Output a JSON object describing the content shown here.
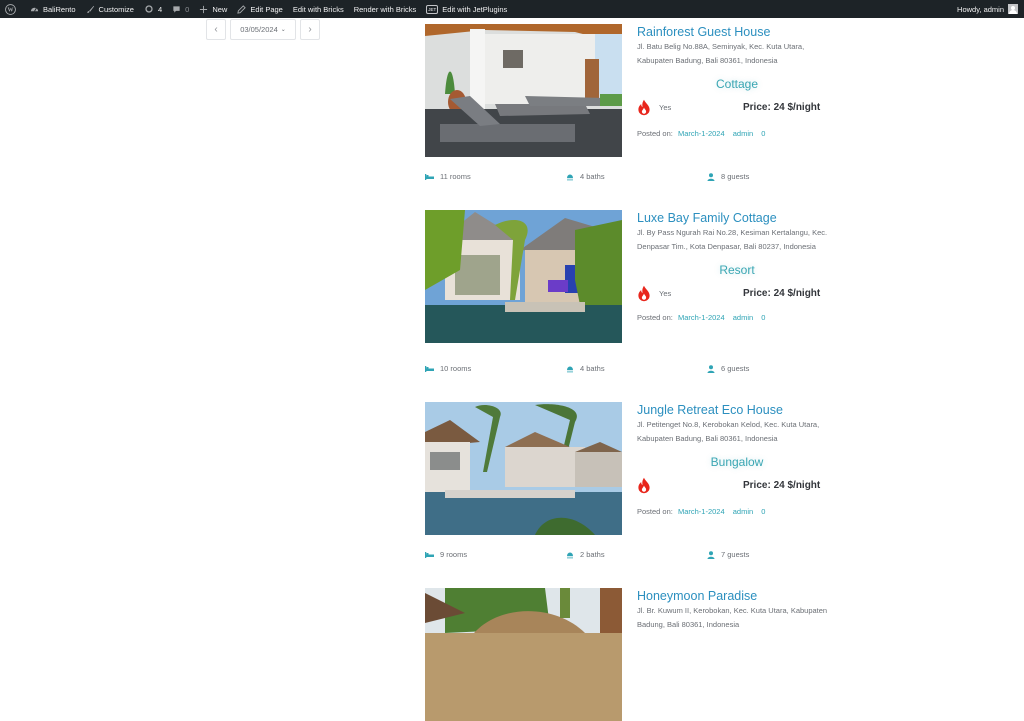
{
  "adminbar": {
    "site_name": "BaliRento",
    "customize": "Customize",
    "updates_count": "4",
    "comments_count": "0",
    "new": "New",
    "edit_page": "Edit Page",
    "edit_bricks": "Edit with Bricks",
    "render_bricks": "Render with Bricks",
    "jet_badge": "JET",
    "edit_jetplugins": "Edit with JetPlugins",
    "howdy": "Howdy, admin"
  },
  "datenav": {
    "prev": "‹",
    "date": "03/05/2024",
    "caret": "⌄",
    "next": "›"
  },
  "labels": {
    "posted_on": "Posted on:",
    "price_prefix": "Price: ",
    "price_suffix": " $/night"
  },
  "listings": [
    {
      "title": "Rainforest Guest House",
      "address": "Jl. Batu Belig No.88A, Seminyak, Kec. Kuta Utara, Kabupaten Badung, Bali 80361, Indonesia",
      "type": "Cottage",
      "hot_label": "Yes",
      "price": "Price: 24 $/night",
      "date": "March-1-2024",
      "author": "admin",
      "comments": "0",
      "rooms": "11 rooms",
      "baths": "4 baths",
      "guests": "8 guests"
    },
    {
      "title": "Luxe Bay Family Cottage",
      "address": "Jl. By Pass Ngurah Rai No.28, Kesiman Kertalangu, Kec. Denpasar Tim., Kota Denpasar, Bali 80237, Indonesia",
      "type": "Resort",
      "hot_label": "Yes",
      "price": "Price: 24 $/night",
      "date": "March-1-2024",
      "author": "admin",
      "comments": "0",
      "rooms": "10 rooms",
      "baths": "4 baths",
      "guests": "6 guests"
    },
    {
      "title": "Jungle Retreat Eco House",
      "address": "Jl. Petitenget No.8, Kerobokan Kelod, Kec. Kuta Utara, Kabupaten Badung, Bali 80361, Indonesia",
      "type": "Bungalow",
      "hot_label": "",
      "price": "Price: 24 $/night",
      "date": "March-1-2024",
      "author": "admin",
      "comments": "0",
      "rooms": "9 rooms",
      "baths": "2 baths",
      "guests": "7 guests"
    },
    {
      "title": "Honeymoon Paradise",
      "address": "Jl. Br. Kuwum II, Kerobokan, Kec. Kuta Utara, Kabupaten Badung, Bali 80361, Indonesia"
    }
  ],
  "colors": {
    "adminbar_bg": "#1d2327",
    "title": "#2b8fbf",
    "accent_teal": "#2fa4b5",
    "hot_red": "#e8261c"
  }
}
